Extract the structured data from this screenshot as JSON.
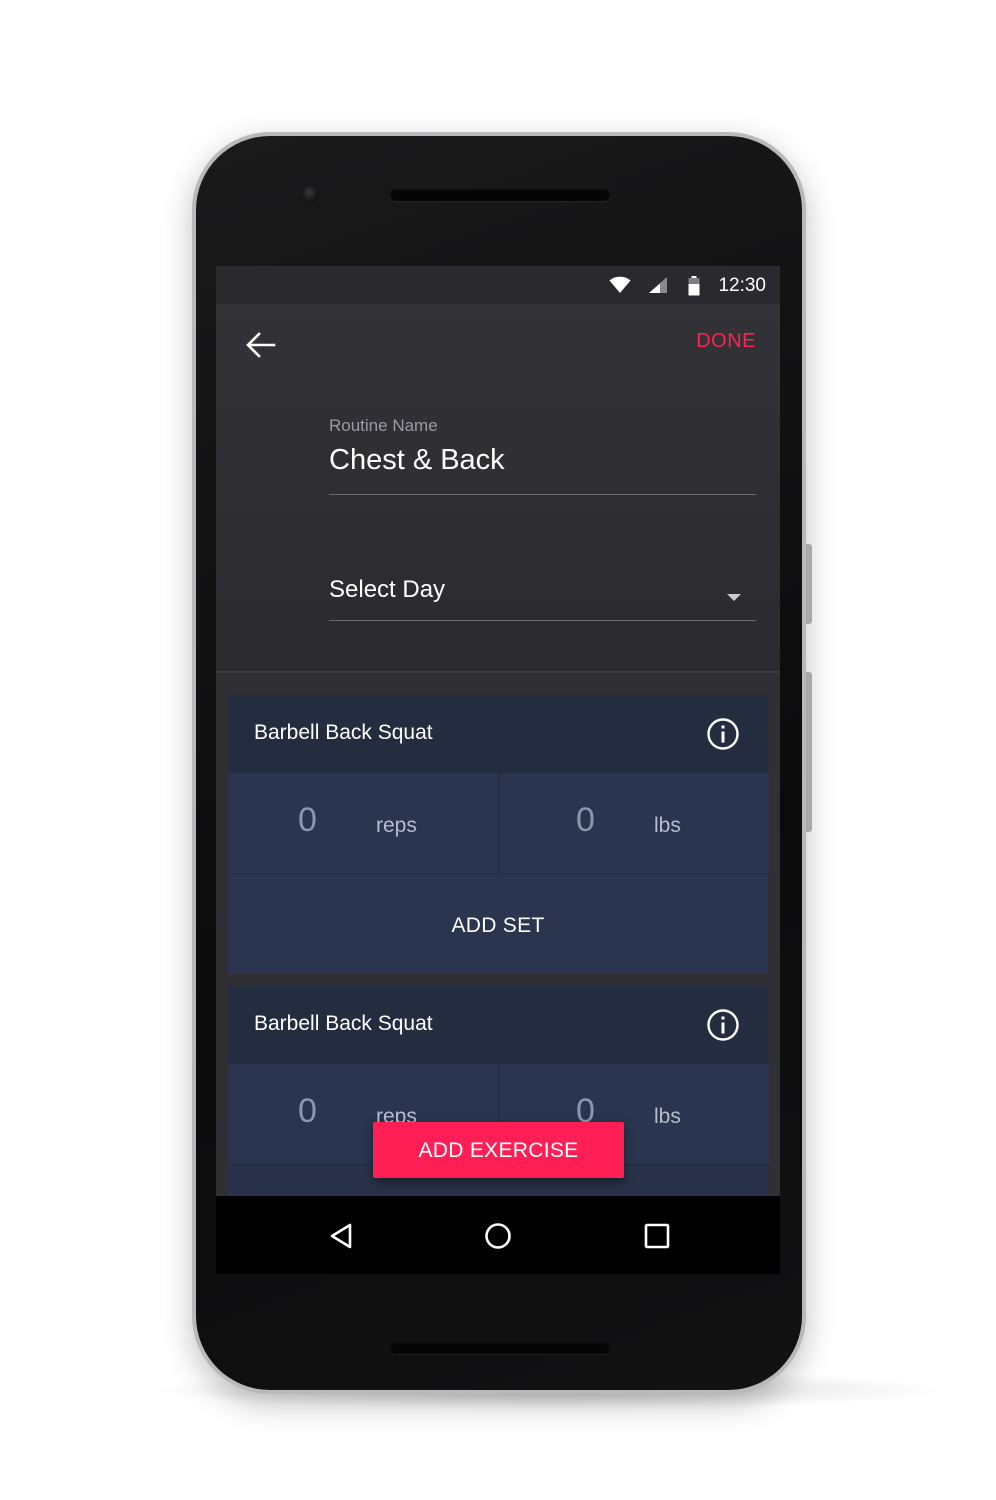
{
  "status_bar": {
    "time": "12:30",
    "icons": [
      "wifi-icon",
      "cell-signal-icon",
      "battery-icon"
    ]
  },
  "app_bar": {
    "back_icon": "arrow-back-icon",
    "done_label": "DONE"
  },
  "routine": {
    "name_label": "Routine Name",
    "name_value": "Chest & Back",
    "day_placeholder": "Select Day"
  },
  "exercises": [
    {
      "title": "Barbell Back Squat",
      "reps_value": "0",
      "reps_unit": "reps",
      "weight_value": "0",
      "weight_unit": "lbs",
      "add_set_label": "ADD SET"
    },
    {
      "title": "Barbell Back Squat",
      "reps_value": "0",
      "reps_unit": "reps",
      "weight_value": "0",
      "weight_unit": "lbs"
    }
  ],
  "fab": {
    "label": "ADD EXERCISE"
  },
  "nav": {
    "icons": [
      "back-triangle-icon",
      "home-circle-icon",
      "recents-square-icon"
    ]
  },
  "colors": {
    "accent": "#ff1f55",
    "card": "#29324a",
    "card_header": "#242c40",
    "background": "#28282c"
  }
}
